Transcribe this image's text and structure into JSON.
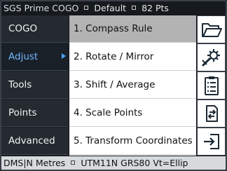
{
  "status_bar": {
    "app_title": "SGS Prime COGO",
    "profile": "Default",
    "points": "82 Pts"
  },
  "left_menu": [
    {
      "label": "COGO",
      "active": false
    },
    {
      "label": "Adjust",
      "active": true
    },
    {
      "label": "Tools",
      "active": false
    },
    {
      "label": "Points",
      "active": false
    },
    {
      "label": "Advanced",
      "active": false
    }
  ],
  "submenu": [
    {
      "label": "1. Compass Rule",
      "selected": true
    },
    {
      "label": "2. Rotate / Mirror",
      "selected": false
    },
    {
      "label": "3. Shift / Average",
      "selected": false
    },
    {
      "label": "4. Scale Points",
      "selected": false
    },
    {
      "label": "5. Transform Coordinates",
      "selected": false
    }
  ],
  "side_icons": [
    "folder-icon",
    "settings-tools-icon",
    "clipboard-checklist-icon",
    "exchange-document-icon",
    "exit-icon"
  ],
  "bottom_bar": {
    "units": "DMS|N Metres",
    "projection": "UTM11N GRS80 Vt=Ellip"
  },
  "colors": {
    "accent": "#4aa3ff",
    "selected_row": "#b3b3b3",
    "menu_bg": "#242a30"
  }
}
